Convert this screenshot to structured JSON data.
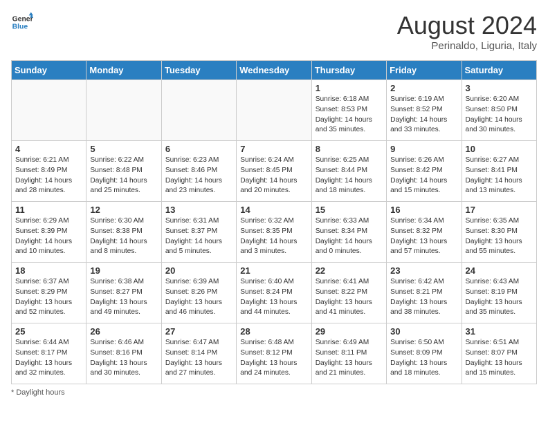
{
  "header": {
    "logo_line1": "General",
    "logo_line2": "Blue",
    "month_year": "August 2024",
    "location": "Perinaldo, Liguria, Italy"
  },
  "days_of_week": [
    "Sunday",
    "Monday",
    "Tuesday",
    "Wednesday",
    "Thursday",
    "Friday",
    "Saturday"
  ],
  "weeks": [
    [
      {
        "day": "",
        "info": ""
      },
      {
        "day": "",
        "info": ""
      },
      {
        "day": "",
        "info": ""
      },
      {
        "day": "",
        "info": ""
      },
      {
        "day": "1",
        "info": "Sunrise: 6:18 AM\nSunset: 8:53 PM\nDaylight: 14 hours and 35 minutes."
      },
      {
        "day": "2",
        "info": "Sunrise: 6:19 AM\nSunset: 8:52 PM\nDaylight: 14 hours and 33 minutes."
      },
      {
        "day": "3",
        "info": "Sunrise: 6:20 AM\nSunset: 8:50 PM\nDaylight: 14 hours and 30 minutes."
      }
    ],
    [
      {
        "day": "4",
        "info": "Sunrise: 6:21 AM\nSunset: 8:49 PM\nDaylight: 14 hours and 28 minutes."
      },
      {
        "day": "5",
        "info": "Sunrise: 6:22 AM\nSunset: 8:48 PM\nDaylight: 14 hours and 25 minutes."
      },
      {
        "day": "6",
        "info": "Sunrise: 6:23 AM\nSunset: 8:46 PM\nDaylight: 14 hours and 23 minutes."
      },
      {
        "day": "7",
        "info": "Sunrise: 6:24 AM\nSunset: 8:45 PM\nDaylight: 14 hours and 20 minutes."
      },
      {
        "day": "8",
        "info": "Sunrise: 6:25 AM\nSunset: 8:44 PM\nDaylight: 14 hours and 18 minutes."
      },
      {
        "day": "9",
        "info": "Sunrise: 6:26 AM\nSunset: 8:42 PM\nDaylight: 14 hours and 15 minutes."
      },
      {
        "day": "10",
        "info": "Sunrise: 6:27 AM\nSunset: 8:41 PM\nDaylight: 14 hours and 13 minutes."
      }
    ],
    [
      {
        "day": "11",
        "info": "Sunrise: 6:29 AM\nSunset: 8:39 PM\nDaylight: 14 hours and 10 minutes."
      },
      {
        "day": "12",
        "info": "Sunrise: 6:30 AM\nSunset: 8:38 PM\nDaylight: 14 hours and 8 minutes."
      },
      {
        "day": "13",
        "info": "Sunrise: 6:31 AM\nSunset: 8:37 PM\nDaylight: 14 hours and 5 minutes."
      },
      {
        "day": "14",
        "info": "Sunrise: 6:32 AM\nSunset: 8:35 PM\nDaylight: 14 hours and 3 minutes."
      },
      {
        "day": "15",
        "info": "Sunrise: 6:33 AM\nSunset: 8:34 PM\nDaylight: 14 hours and 0 minutes."
      },
      {
        "day": "16",
        "info": "Sunrise: 6:34 AM\nSunset: 8:32 PM\nDaylight: 13 hours and 57 minutes."
      },
      {
        "day": "17",
        "info": "Sunrise: 6:35 AM\nSunset: 8:30 PM\nDaylight: 13 hours and 55 minutes."
      }
    ],
    [
      {
        "day": "18",
        "info": "Sunrise: 6:37 AM\nSunset: 8:29 PM\nDaylight: 13 hours and 52 minutes."
      },
      {
        "day": "19",
        "info": "Sunrise: 6:38 AM\nSunset: 8:27 PM\nDaylight: 13 hours and 49 minutes."
      },
      {
        "day": "20",
        "info": "Sunrise: 6:39 AM\nSunset: 8:26 PM\nDaylight: 13 hours and 46 minutes."
      },
      {
        "day": "21",
        "info": "Sunrise: 6:40 AM\nSunset: 8:24 PM\nDaylight: 13 hours and 44 minutes."
      },
      {
        "day": "22",
        "info": "Sunrise: 6:41 AM\nSunset: 8:22 PM\nDaylight: 13 hours and 41 minutes."
      },
      {
        "day": "23",
        "info": "Sunrise: 6:42 AM\nSunset: 8:21 PM\nDaylight: 13 hours and 38 minutes."
      },
      {
        "day": "24",
        "info": "Sunrise: 6:43 AM\nSunset: 8:19 PM\nDaylight: 13 hours and 35 minutes."
      }
    ],
    [
      {
        "day": "25",
        "info": "Sunrise: 6:44 AM\nSunset: 8:17 PM\nDaylight: 13 hours and 32 minutes."
      },
      {
        "day": "26",
        "info": "Sunrise: 6:46 AM\nSunset: 8:16 PM\nDaylight: 13 hours and 30 minutes."
      },
      {
        "day": "27",
        "info": "Sunrise: 6:47 AM\nSunset: 8:14 PM\nDaylight: 13 hours and 27 minutes."
      },
      {
        "day": "28",
        "info": "Sunrise: 6:48 AM\nSunset: 8:12 PM\nDaylight: 13 hours and 24 minutes."
      },
      {
        "day": "29",
        "info": "Sunrise: 6:49 AM\nSunset: 8:11 PM\nDaylight: 13 hours and 21 minutes."
      },
      {
        "day": "30",
        "info": "Sunrise: 6:50 AM\nSunset: 8:09 PM\nDaylight: 13 hours and 18 minutes."
      },
      {
        "day": "31",
        "info": "Sunrise: 6:51 AM\nSunset: 8:07 PM\nDaylight: 13 hours and 15 minutes."
      }
    ]
  ],
  "footer": {
    "note": "Daylight hours"
  }
}
